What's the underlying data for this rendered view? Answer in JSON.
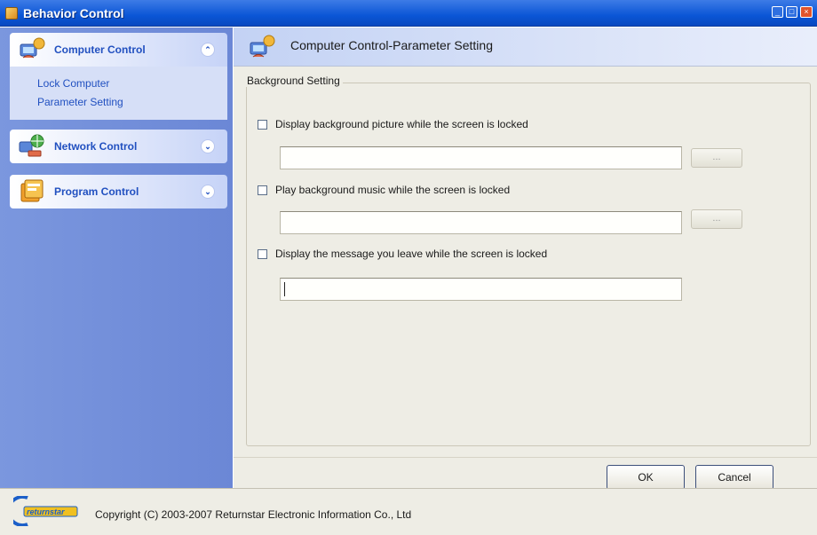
{
  "window": {
    "title": "Behavior Control",
    "controls": [
      "minimize-icon",
      "maximize-icon",
      "close-icon"
    ]
  },
  "sidebar": {
    "groups": [
      {
        "label": "Computer Control",
        "icon": "computer-control-icon",
        "expanded": true,
        "toggle_glyph": "⌃",
        "items": [
          {
            "label": "Lock Computer"
          },
          {
            "label": "Parameter Setting"
          }
        ]
      },
      {
        "label": "Network Control",
        "icon": "network-control-icon",
        "expanded": false,
        "toggle_glyph": "⌄"
      },
      {
        "label": "Program Control",
        "icon": "program-control-icon",
        "expanded": false,
        "toggle_glyph": "⌄"
      }
    ]
  },
  "main": {
    "title": "Computer Control-Parameter Setting",
    "group_title": "Background Setting",
    "options": [
      {
        "label": "Display background picture while the screen is locked",
        "checked": false,
        "value": "",
        "has_browse": true,
        "browse_label": "..."
      },
      {
        "label": "Play background music while the screen is locked",
        "checked": false,
        "value": "",
        "has_browse": true,
        "browse_label": "..."
      },
      {
        "label": "Display the message you leave while the screen is locked",
        "checked": false,
        "value": "",
        "has_browse": false
      }
    ],
    "ok_label": "OK",
    "cancel_label": "Cancel"
  },
  "status": {
    "logo_text": "returnstar",
    "copyright": "Copyright (C) 2003-2007 Returnstar Electronic Information Co., Ltd"
  },
  "colors": {
    "titlebar": "#0b56d6",
    "sidebar": "#7b97de",
    "link": "#2150c0",
    "panel": "#eeede5"
  }
}
